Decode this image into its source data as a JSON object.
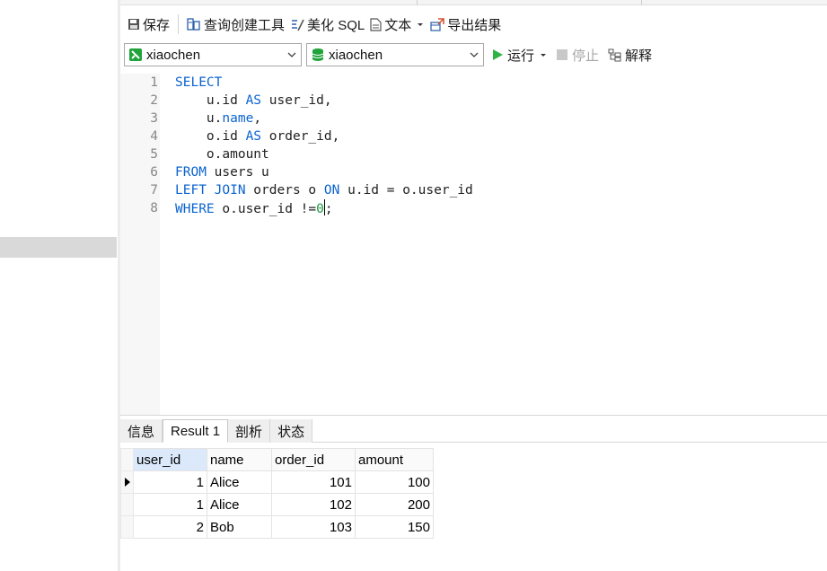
{
  "toolbar": {
    "save": "保存",
    "query_builder": "查询创建工具",
    "beautify": "美化 SQL",
    "text": "文本",
    "export": "导出结果"
  },
  "selectors": {
    "connection": "xiaochen",
    "database": "xiaochen"
  },
  "run_bar": {
    "run": "运行",
    "stop": "停止",
    "explain": "解释"
  },
  "editor": {
    "line_numbers": [
      "1",
      "2",
      "3",
      "4",
      "5",
      "6",
      "7",
      "8"
    ],
    "lines": [
      [
        {
          "t": "SELECT",
          "c": "kw"
        }
      ],
      [
        {
          "t": "    u.id "
        },
        {
          "t": "AS",
          "c": "kw"
        },
        {
          "t": " user_id,"
        }
      ],
      [
        {
          "t": "    u."
        },
        {
          "t": "name",
          "c": "kw"
        },
        {
          "t": ","
        }
      ],
      [
        {
          "t": "    o.id "
        },
        {
          "t": "AS",
          "c": "kw"
        },
        {
          "t": " order_id,"
        }
      ],
      [
        {
          "t": "    o.amount"
        }
      ],
      [
        {
          "t": "FROM",
          "c": "kw"
        },
        {
          "t": " users u"
        }
      ],
      [
        {
          "t": "LEFT JOIN",
          "c": "kw"
        },
        {
          "t": " orders o "
        },
        {
          "t": "ON",
          "c": "kw"
        },
        {
          "t": " u.id = o.user_id"
        }
      ],
      [
        {
          "t": "WHERE",
          "c": "kw"
        },
        {
          "t": " o.user_id !="
        },
        {
          "t": "0",
          "c": "num"
        },
        {
          "t": ";",
          "caret": true
        }
      ]
    ]
  },
  "result_tabs": [
    "信息",
    "Result 1",
    "剖析",
    "状态"
  ],
  "result_active_tab": 1,
  "grid": {
    "columns": [
      "user_id",
      "name",
      "order_id",
      "amount"
    ],
    "rows": [
      [
        "1",
        "Alice",
        "101",
        "100"
      ],
      [
        "1",
        "Alice",
        "102",
        "200"
      ],
      [
        "2",
        "Bob",
        "103",
        "150"
      ]
    ]
  },
  "colors": {
    "keyword": "#0b63d0",
    "number": "#1a9b3a",
    "run_green": "#2fb344",
    "selection": "#dbe9fb"
  }
}
